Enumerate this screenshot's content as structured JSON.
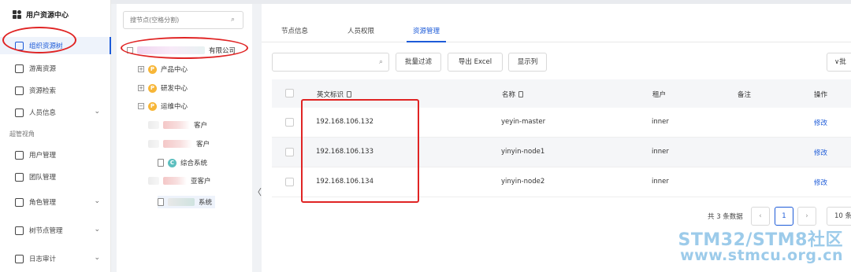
{
  "sidebar": {
    "brand": "用户资源中心",
    "items": [
      {
        "label": "组织资源树",
        "icon": "tree-icon"
      },
      {
        "label": "游离资源",
        "icon": "cube-icon"
      },
      {
        "label": "资源检索",
        "icon": "cube-search-icon"
      },
      {
        "label": "人员信息",
        "icon": "person-card-icon"
      }
    ],
    "section": "超管视角",
    "admin_items": [
      {
        "label": "用户管理",
        "icon": "user-gear-icon"
      },
      {
        "label": "团队管理",
        "icon": "team-icon"
      },
      {
        "label": "角色管理",
        "icon": "role-icon"
      },
      {
        "label": "树节点管理",
        "icon": "sliders-icon"
      },
      {
        "label": "日志审计",
        "icon": "log-icon"
      }
    ]
  },
  "tree": {
    "search_placeholder": "搜节点(空格分割)",
    "root_suffix": "有限公司",
    "nodes": [
      {
        "label": "产品中心",
        "badge": "P",
        "toggle": "+"
      },
      {
        "label": "研发中心",
        "badge": "P",
        "toggle": "+"
      },
      {
        "label": "运维中心",
        "badge": "P",
        "toggle": "−"
      }
    ],
    "sub1": "客户",
    "sub2": "客户",
    "leaf1": "综合系统",
    "leaf1_badge": "C",
    "sub3": "亚客户",
    "leaf2": "系统",
    "collapse_glyph": "〈"
  },
  "tabs": [
    "节点信息",
    "人员权限",
    "资源管理"
  ],
  "toolbar": {
    "search_icon": "search-icon",
    "batch_filter": "批量过滤",
    "export": "导出 Excel",
    "columns": "显示列",
    "batch_right": "∨批"
  },
  "table": {
    "headers": [
      "英文标识",
      "名称",
      "租户",
      "备注",
      "操作"
    ],
    "rows": [
      {
        "id": "192.168.106.132",
        "name": "yeyin-master",
        "tenant": "inner",
        "note": "",
        "action": "修改"
      },
      {
        "id": "192.168.106.133",
        "name": "yinyin-node1",
        "tenant": "inner",
        "note": "",
        "action": "修改"
      },
      {
        "id": "192.168.106.134",
        "name": "yinyin-node2",
        "tenant": "inner",
        "note": "",
        "action": "修改"
      }
    ]
  },
  "pager": {
    "total": "共 3 条数据",
    "prev": "‹",
    "page": "1",
    "next": "›",
    "size": "10 条"
  },
  "watermark": {
    "line1": "STM32/STM8社区",
    "line2": "www.stmcu.org.cn"
  },
  "colors": {
    "accent": "#1d5bd8",
    "annotation": "#e02424",
    "watermark": "#9ccbea"
  }
}
